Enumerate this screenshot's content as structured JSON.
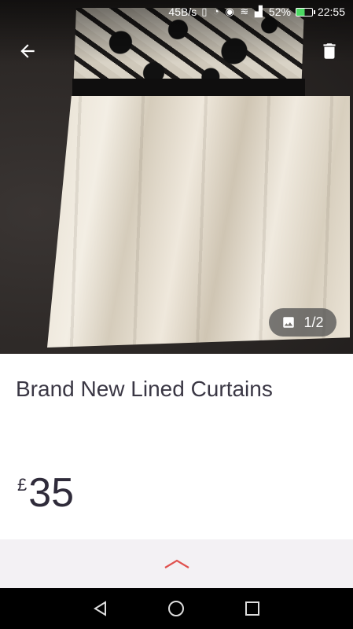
{
  "status_bar": {
    "network_speed": "45B/s",
    "battery_percent": "52%",
    "time": "22:55",
    "battery_level": 0.52
  },
  "gallery": {
    "counter": "1/2",
    "current_index": 1,
    "total": 2
  },
  "listing": {
    "title": "Brand New Lined Curtains",
    "currency_symbol": "£",
    "price": "35"
  },
  "icons": {
    "back": "arrow-left-icon",
    "delete": "trash-icon",
    "gallery": "image-icon",
    "expand": "chevron-up-icon",
    "nav_back": "triangle-back-icon",
    "nav_home": "circle-home-icon",
    "nav_recents": "square-recents-icon"
  },
  "colors": {
    "accent": "#e0524f",
    "title_text": "#3a3744",
    "expand_bar_bg": "#f3f1f4"
  }
}
